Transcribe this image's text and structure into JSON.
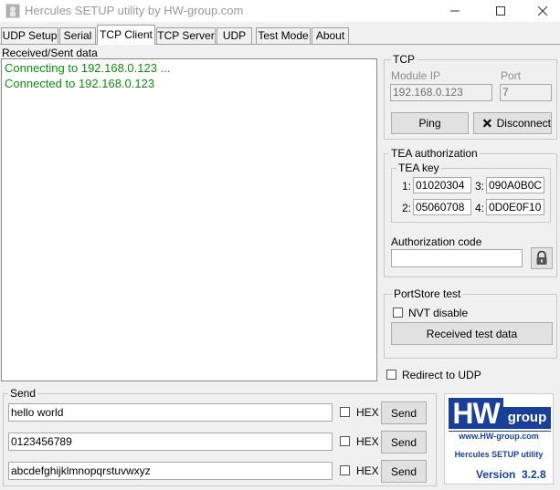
{
  "window": {
    "title": "Hercules SETUP utility by HW-group.com",
    "controls": {
      "minimize": "—",
      "maximize": "☐",
      "close": "✕"
    }
  },
  "tabs": [
    {
      "label": "UDP Setup"
    },
    {
      "label": "Serial"
    },
    {
      "label": "TCP Client",
      "active": true
    },
    {
      "label": "TCP Server"
    },
    {
      "label": "UDP"
    },
    {
      "label": "Test Mode"
    },
    {
      "label": "About"
    }
  ],
  "received": {
    "label": "Received/Sent data",
    "lines": [
      "Connecting to 192.168.0.123 ...",
      "Connected to 192.168.0.123"
    ],
    "line_color": "#138a13"
  },
  "tcp": {
    "title": "TCP",
    "module_ip_label": "Module IP",
    "module_ip_value": "192.168.0.123",
    "port_label": "Port",
    "port_value": "7",
    "ping_label": "Ping",
    "disconnect_label": "Disconnect"
  },
  "tea": {
    "title": "TEA authorization",
    "key_title": "TEA key",
    "keys": [
      {
        "num": "1:",
        "value": "01020304"
      },
      {
        "num": "3:",
        "value": "090A0B0C"
      },
      {
        "num": "2:",
        "value": "05060708"
      },
      {
        "num": "4:",
        "value": "0D0E0F10"
      }
    ],
    "auth_code_label": "Authorization code",
    "auth_code_value": ""
  },
  "portstore": {
    "title": "PortStore test",
    "nvt_disable_label": "NVT disable",
    "nvt_disable_checked": false,
    "received_test_data_label": "Received test data"
  },
  "redirect": {
    "label": "Redirect to UDP",
    "checked": false
  },
  "send": {
    "title": "Send",
    "rows": [
      {
        "value": "hello world",
        "hex_label": "HEX",
        "hex_checked": false,
        "button": "Send"
      },
      {
        "value": "0123456789",
        "hex_label": "HEX",
        "hex_checked": false,
        "button": "Send"
      },
      {
        "value": "abcdefghijklmnopqrstuvwxyz",
        "hex_label": "HEX",
        "hex_checked": false,
        "button": "Send"
      }
    ]
  },
  "logo": {
    "brand": "HW",
    "group": "group",
    "url": "www.HW-group.com",
    "product": "Hercules SETUP utility",
    "version_label": "Version",
    "version": "3.2.8",
    "brand_color": "#1a3f96"
  }
}
